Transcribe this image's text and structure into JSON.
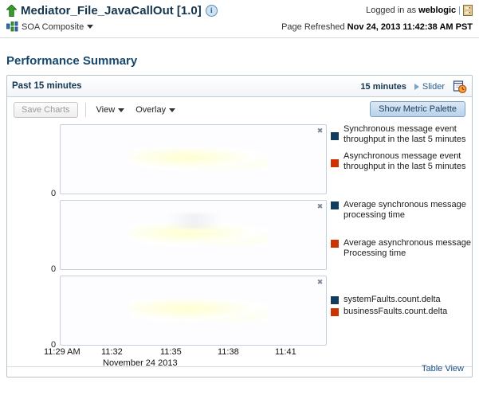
{
  "header": {
    "up_arrow_icon": "up-arrow-icon",
    "title": "Mediator_File_JavaCallOut [1.0]",
    "info_icon": "i",
    "soa_icon": "soa-composite-icon",
    "composite_label": "SOA Composite",
    "logged_in_label": "Logged in as",
    "user": "weblogic",
    "separator_bar": "|",
    "server_icon": "server-icon",
    "page_refreshed_label": "Page Refreshed",
    "page_refreshed_value": "Nov 24, 2013 11:42:38 AM PST"
  },
  "section": {
    "title": "Performance Summary"
  },
  "panel": {
    "header_title": "Past 15 minutes",
    "minutes_label": "15 minutes",
    "slider_label": "Slider",
    "clock_icon": "calendar-clock-icon"
  },
  "toolbar": {
    "save_charts_label": "Save Charts",
    "view_label": "View",
    "overlay_label": "Overlay",
    "show_metric_palette_label": "Show Metric Palette"
  },
  "colors": {
    "series_blue": "#123c5e",
    "series_orange": "#cc3300",
    "accent_link": "#1b4d84",
    "title_blue": "#15486e"
  },
  "charts": [
    {
      "y_zero": "0",
      "close_icon": "close-icon",
      "legend": [
        {
          "color": "#123c5e",
          "label": "Synchronous message event throughput in the last 5 minutes"
        },
        {
          "color": "#cc3300",
          "label": "Asynchronous message event throughput in the last 5 minutes"
        }
      ]
    },
    {
      "y_zero": "0",
      "close_icon": "close-icon",
      "legend": [
        {
          "color": "#123c5e",
          "label": "Average synchronous message processing time"
        },
        {
          "color": "#cc3300",
          "label": "Average asynchronous message Processing time"
        }
      ]
    },
    {
      "y_zero": "0",
      "close_icon": "close-icon",
      "legend": [
        {
          "color": "#123c5e",
          "label": "systemFaults.count.delta"
        },
        {
          "color": "#cc3300",
          "label": "businessFaults.count.delta"
        }
      ]
    }
  ],
  "chart_data": {
    "type": "line",
    "title": "Performance Summary",
    "xlabel": "November 24 2013",
    "x_tick_labels": [
      "11:29 AM",
      "11:32",
      "11:35",
      "11:38",
      "11:41"
    ],
    "x_tick_positions": [
      40,
      112,
      186,
      258,
      330
    ],
    "date_label": "November 24 2013",
    "panels": [
      {
        "ylabel": "",
        "ytick_labels": [
          "0"
        ],
        "ylim": [
          0,
          1
        ],
        "grid": false,
        "series": [
          {
            "name": "Synchronous message event throughput in the last 5 minutes",
            "color": "#123c5e",
            "values": [
              0,
              0,
              0,
              0,
              0
            ]
          },
          {
            "name": "Asynchronous message event throughput in the last 5 minutes",
            "color": "#cc3300",
            "values": [
              0,
              0,
              0,
              0,
              0
            ]
          }
        ]
      },
      {
        "ylabel": "",
        "ytick_labels": [
          "0"
        ],
        "ylim": [
          0,
          1
        ],
        "grid": false,
        "series": [
          {
            "name": "Average synchronous message processing time",
            "color": "#123c5e",
            "values": [
              0,
              0,
              0,
              0,
              0
            ]
          },
          {
            "name": "Average asynchronous message Processing time",
            "color": "#cc3300",
            "values": [
              0,
              0,
              0,
              0,
              0
            ]
          }
        ]
      },
      {
        "ylabel": "",
        "ytick_labels": [
          "0"
        ],
        "ylim": [
          0,
          1
        ],
        "grid": false,
        "series": [
          {
            "name": "systemFaults.count.delta",
            "color": "#123c5e",
            "values": [
              0,
              0,
              0,
              0,
              0
            ]
          },
          {
            "name": "businessFaults.count.delta",
            "color": "#cc3300",
            "values": [
              0,
              0,
              0,
              0,
              0
            ]
          }
        ]
      }
    ],
    "legend_position": "right"
  },
  "footer": {
    "table_view_label": "Table View"
  }
}
